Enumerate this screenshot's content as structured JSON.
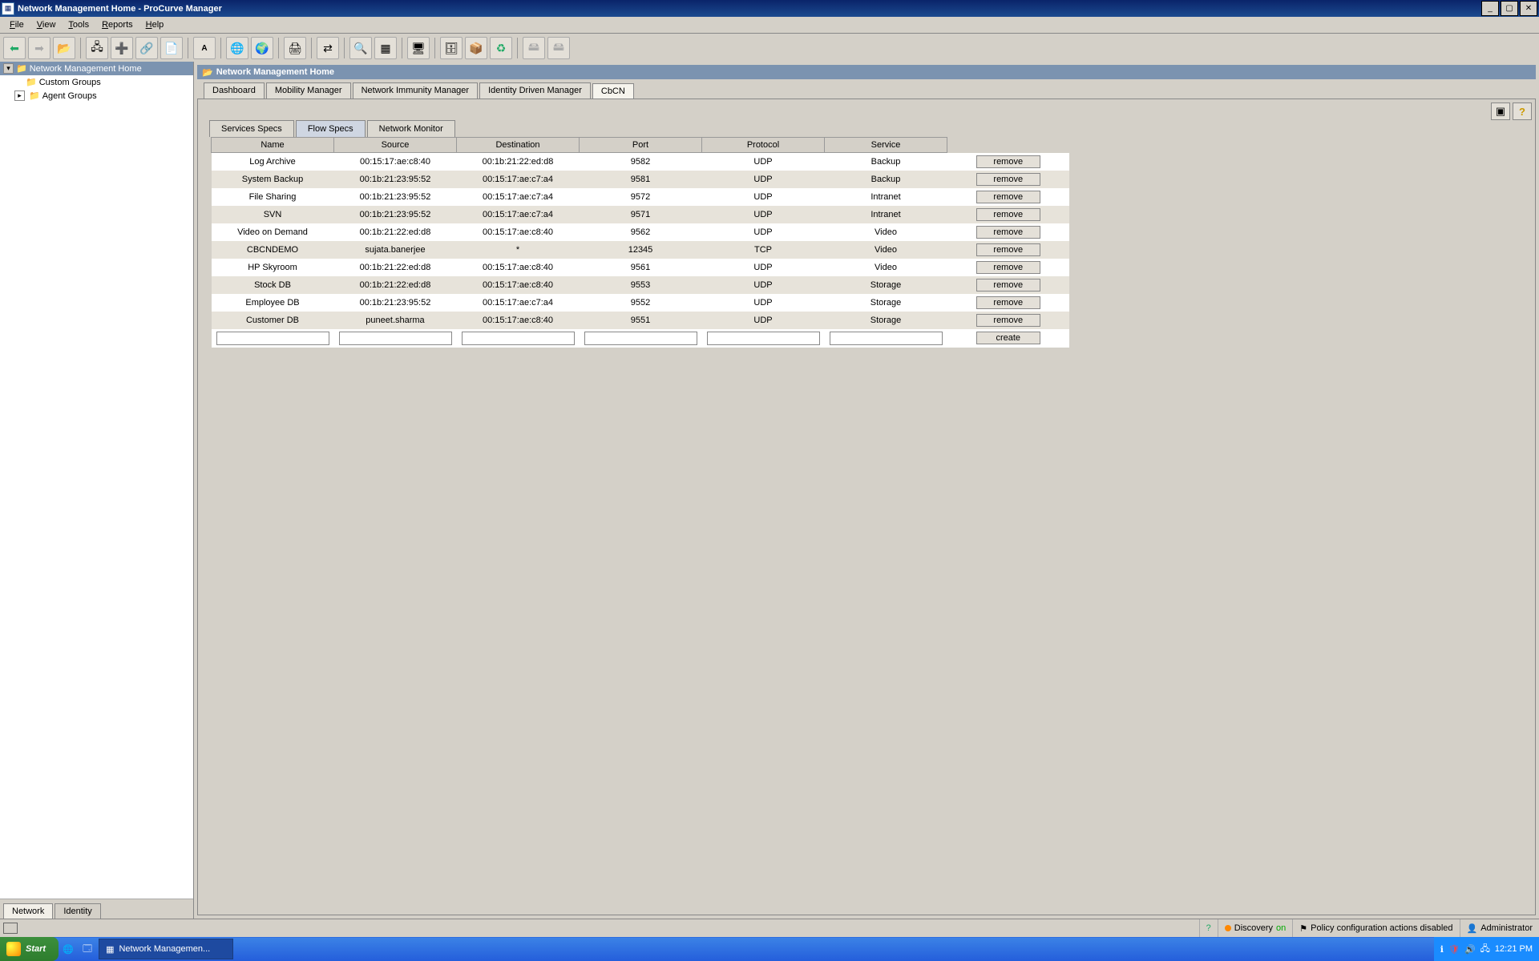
{
  "window": {
    "title": "Network Management Home - ProCurve Manager"
  },
  "menus": {
    "file": "File",
    "view": "View",
    "tools": "Tools",
    "reports": "Reports",
    "help": "Help"
  },
  "tree": {
    "root": "Network Management Home",
    "custom_groups": "Custom Groups",
    "agent_groups": "Agent Groups"
  },
  "left_bottom_tabs": {
    "network": "Network",
    "identity": "Identity"
  },
  "breadcrumb": "Network Management Home",
  "main_tabs": {
    "dashboard": "Dashboard",
    "mobility": "Mobility Manager",
    "immunity": "Network Immunity Manager",
    "identity": "Identity Driven Manager",
    "cbcn": "CbCN"
  },
  "sub_tabs": {
    "services": "Services Specs",
    "flow": "Flow Specs",
    "monitor": "Network Monitor"
  },
  "table": {
    "headers": {
      "name": "Name",
      "source": "Source",
      "dest": "Destination",
      "port": "Port",
      "protocol": "Protocol",
      "service": "Service"
    },
    "action_remove": "remove",
    "action_create": "create",
    "rows": [
      {
        "name": "Log Archive",
        "source": "00:15:17:ae:c8:40",
        "dest": "00:1b:21:22:ed:d8",
        "port": "9582",
        "protocol": "UDP",
        "service": "Backup"
      },
      {
        "name": "System Backup",
        "source": "00:1b:21:23:95:52",
        "dest": "00:15:17:ae:c7:a4",
        "port": "9581",
        "protocol": "UDP",
        "service": "Backup"
      },
      {
        "name": "File Sharing",
        "source": "00:1b:21:23:95:52",
        "dest": "00:15:17:ae:c7:a4",
        "port": "9572",
        "protocol": "UDP",
        "service": "Intranet"
      },
      {
        "name": "SVN",
        "source": "00:1b:21:23:95:52",
        "dest": "00:15:17:ae:c7:a4",
        "port": "9571",
        "protocol": "UDP",
        "service": "Intranet"
      },
      {
        "name": "Video on Demand",
        "source": "00:1b:21:22:ed:d8",
        "dest": "00:15:17:ae:c8:40",
        "port": "9562",
        "protocol": "UDP",
        "service": "Video"
      },
      {
        "name": "CBCNDEMO",
        "source": "sujata.banerjee",
        "dest": "*",
        "port": "12345",
        "protocol": "TCP",
        "service": "Video"
      },
      {
        "name": "HP Skyroom",
        "source": "00:1b:21:22:ed:d8",
        "dest": "00:15:17:ae:c8:40",
        "port": "9561",
        "protocol": "UDP",
        "service": "Video"
      },
      {
        "name": "Stock DB",
        "source": "00:1b:21:22:ed:d8",
        "dest": "00:15:17:ae:c8:40",
        "port": "9553",
        "protocol": "UDP",
        "service": "Storage"
      },
      {
        "name": "Employee DB",
        "source": "00:1b:21:23:95:52",
        "dest": "00:15:17:ae:c7:a4",
        "port": "9552",
        "protocol": "UDP",
        "service": "Storage"
      },
      {
        "name": "Customer DB",
        "source": "puneet.sharma",
        "dest": "00:15:17:ae:c8:40",
        "port": "9551",
        "protocol": "UDP",
        "service": "Storage"
      }
    ]
  },
  "status": {
    "discovery_label": "Discovery",
    "discovery_state": "on",
    "policy": "Policy configuration actions disabled",
    "user": "Administrator"
  },
  "taskbar": {
    "start": "Start",
    "app": "Network Managemen...",
    "clock": "12:21 PM"
  }
}
